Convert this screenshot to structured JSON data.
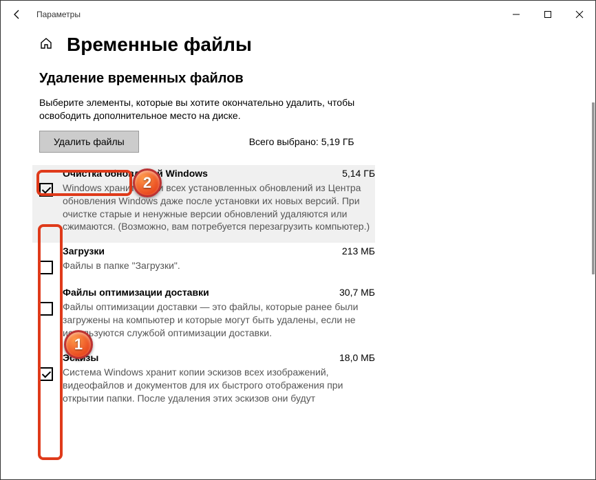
{
  "window": {
    "title": "Параметры"
  },
  "page": {
    "title": "Временные файлы",
    "section_title": "Удаление временных файлов",
    "instruction": "Выберите элементы, которые вы хотите окончательно удалить, чтобы освободить дополнительное место на диске.",
    "delete_button": "Удалить файлы",
    "total_label": "Всего выбрано: 5,19 ГБ"
  },
  "items": [
    {
      "name": "Очистка обновлений Windows",
      "size": "5,14 ГБ",
      "desc": "Windows хранит копии всех установленных обновлений из Центра обновления Windows даже после установки их новых версий. При очистке старые и ненужные версии обновлений удаляются или сжимаются. (Возможно, вам потребуется перезагрузить компьютер.)",
      "checked": true
    },
    {
      "name": "Загрузки",
      "size": "213 МБ",
      "desc": "Файлы в папке \"Загрузки\".",
      "checked": false
    },
    {
      "name": "Файлы оптимизации доставки",
      "size": "30,7 МБ",
      "desc": "Файлы оптимизации доставки — это файлы, которые ранее были загружены на компьютер и которые могут быть удалены, если не используются службой оптимизации доставки.",
      "checked": false
    },
    {
      "name": "Эскизы",
      "size": "18,0 МБ",
      "desc": "Система Windows хранит копии эскизов всех изображений, видеофайлов и документов для их быстрого отображения при открытии папки. После удаления этих эскизов они будут",
      "checked": true
    }
  ],
  "annotations": {
    "badge1": "1",
    "badge2": "2"
  }
}
